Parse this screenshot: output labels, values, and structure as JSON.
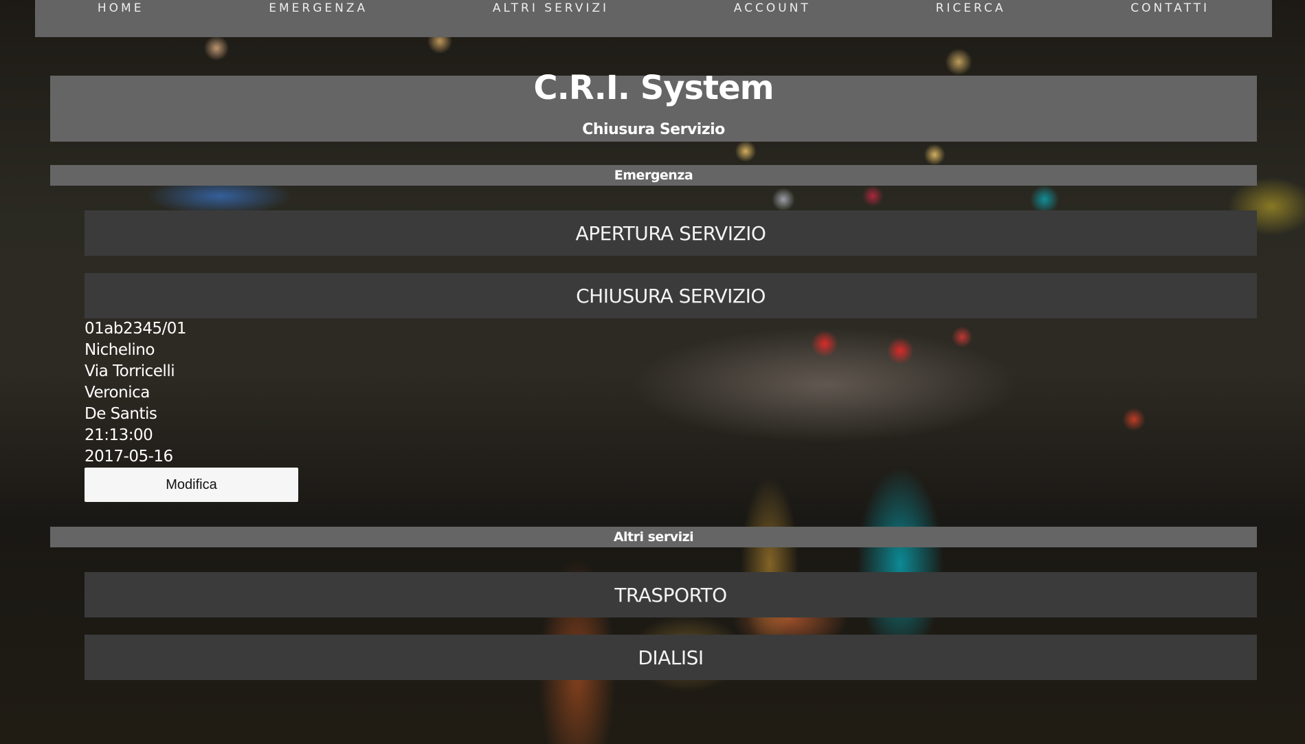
{
  "nav": {
    "items": [
      "HOME",
      "EMERGENZA",
      "ALTRI SERVIZI",
      "ACCOUNT",
      "RICERCA",
      "CONTATTI"
    ]
  },
  "header": {
    "title": "C.R.I. System",
    "subtitle": "Chiusura Servizio"
  },
  "emergenza": {
    "label": "Emergenza",
    "buttons": [
      "APERTURA SERVIZIO",
      "CHIUSURA SERVIZIO"
    ],
    "service": {
      "code": "01ab2345/01",
      "city": "Nichelino",
      "street": "Via Torricelli",
      "first_name": "Veronica",
      "last_name": "De Santis",
      "time": "21:13:00",
      "date": "2017-05-16"
    },
    "edit_button": "Modifica"
  },
  "altri_servizi": {
    "label": "Altri servizi",
    "buttons": [
      "TRASPORTO",
      "DIALISI"
    ]
  }
}
